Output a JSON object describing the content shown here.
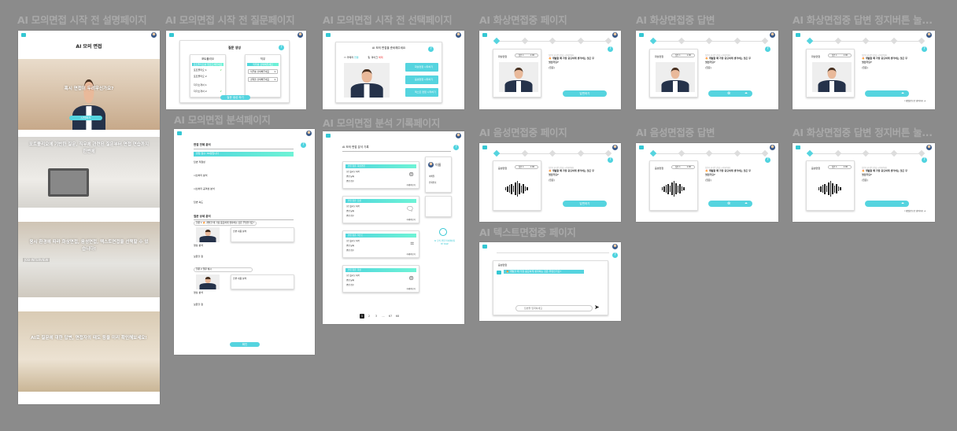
{
  "frames": {
    "intro": {
      "title": "AI 모의면접 시작 전 설명페이지",
      "header": "AI 모의 면접",
      "hero1": "혹시 면접이 두려우신가요?",
      "start_button": "시작하기",
      "hero2": "포트폴리오에 기반한 질문, 직무에 관련된 질문부터 면접 연습까지 한번에",
      "hero3": "응시 환경에 따라 화상면접, 음성면접, 텍스트면접을 선택할 수 있습니다!",
      "hero3_badge": "JOB INTERVIEW",
      "hero4": "AI로 질문에 대한 답변, 면접자의 태도 등을 미리 확인해보세요!"
    },
    "question": {
      "title": "AI 모의면접 시작 전 질문페이지",
      "heading": "질문 생성",
      "portfolio": "포트폴리오",
      "job": "직무",
      "portfolio_bar": "포트폴리오를 업로드해주세요",
      "job_bar": "직무를 선택해주세요",
      "files": [
        "포트폴리오 1",
        "포트폴리오 2",
        "자기소개서 1",
        "자기소개서 2"
      ],
      "selects": [
        "직무를 선택해주세요",
        "경력을 선택해주세요"
      ],
      "generate_button": "질문 생성 하기"
    },
    "select": {
      "title": "AI 모의면접 시작 전 선택페이지",
      "heading": "AI 모의 면접을 준비해주세요",
      "camera": "카메라",
      "mic": "마이크",
      "camera_status": "연결",
      "mic_status": "해제",
      "options": [
        "화상면접 시작하기",
        "음성면접 시작하기",
        "텍스트 면접 시작하기"
      ]
    },
    "analysis": {
      "title": "AI 모의면접 분석페이지",
      "overall": "면접 전체 분석",
      "overall_bar": "면접 점수: 80점입니다",
      "items": [
        "답변 적절성",
        "시선처리 분석",
        "시선처리 공격성 분석",
        "답변 속도"
      ],
      "detail": "질문 상세 분석",
      "q1": "질문 1 🔥 개발할 때 가장 중요하게 생각하는 것은 무엇인가요?",
      "answer_label": "답변 내용 분석",
      "video_label": "영상 분석",
      "improve": "보완할 점",
      "q2": "질문 2 질문 예시",
      "confirm": "확인"
    },
    "record": {
      "title": "AI 모의면접 분석 기록페이지",
      "heading": "AI 모의 면접 분석 기록",
      "cards": [
        {
          "bar": "면접 종류: 화상면접",
          "lines": [
            "포트폴리오 제목",
            "면접 날짜",
            "면접 점수"
          ],
          "link": "자세히보기"
        },
        {
          "bar": "면접 종류: 음성",
          "lines": [
            "포트폴리오 제목",
            "면접 날짜",
            "면접 점수"
          ],
          "link": "자세히보기"
        },
        {
          "bar": "면접 종류: 텍스트",
          "lines": [
            "포트폴리오 제목",
            "면접 날짜",
            "면접 점수"
          ],
          "link": "자세히보기"
        },
        {
          "bar": "면접 종류: 화상",
          "lines": [
            "포트폴리오 제목",
            "면접 날짜",
            "면접 점수"
          ],
          "link": "자세히보기"
        }
      ],
      "profile_name": "이름",
      "profile_lines": [
        "이메일",
        "전화번호"
      ],
      "brand": "AI 모의 면접 마이페이지",
      "brand_sub": "MY PAGE",
      "pages": [
        "1",
        "2",
        "3",
        "...",
        "67",
        "68"
      ]
    },
    "interviews": [
      {
        "title": "AI 화상면접중 페이지",
        "mode": "video",
        "label": "화상면접",
        "variant": "start"
      },
      {
        "title": "AI 화상면접중 답변",
        "mode": "video",
        "label": "화상면접",
        "variant": "answer"
      },
      {
        "title": "AI 화상면접중 답변 정지버튼 눌...",
        "mode": "video",
        "label": "화상면접",
        "variant": "stop"
      },
      {
        "title": "AI 음성면접중 페이지",
        "mode": "audio",
        "label": "음성면접",
        "variant": "start"
      },
      {
        "title": "AI 음성면접중 답변",
        "mode": "audio",
        "label": "음성면접",
        "variant": "answer"
      },
      {
        "title": "AI 화상면접중 답변 정지버튼 눌...",
        "mode": "audio",
        "label": "음성면접",
        "variant": "stop"
      }
    ],
    "interview_common": {
      "pill": "질문 1",
      "timer": "1:00",
      "hint": "질문이 끝나면 답변을 시작해주세요",
      "question": "🔥 개발할 때 가장 중요하게 생각하는 것은 무엇인가요?",
      "tag": "(질문)",
      "answer_button": "답변하기",
      "next": "다음질문으로 넘어가기 ➜"
    },
    "text": {
      "title": "AI 텍스트면접중 페이지",
      "label": "음성면접",
      "bubble": "🔥 개발할 때 가장 중요하게 생각하는 것은 무엇인가요?",
      "placeholder": "답변을 입력하세요"
    }
  },
  "colors": {
    "accent": "#55d4df",
    "canvas": "#8b8b8b"
  }
}
